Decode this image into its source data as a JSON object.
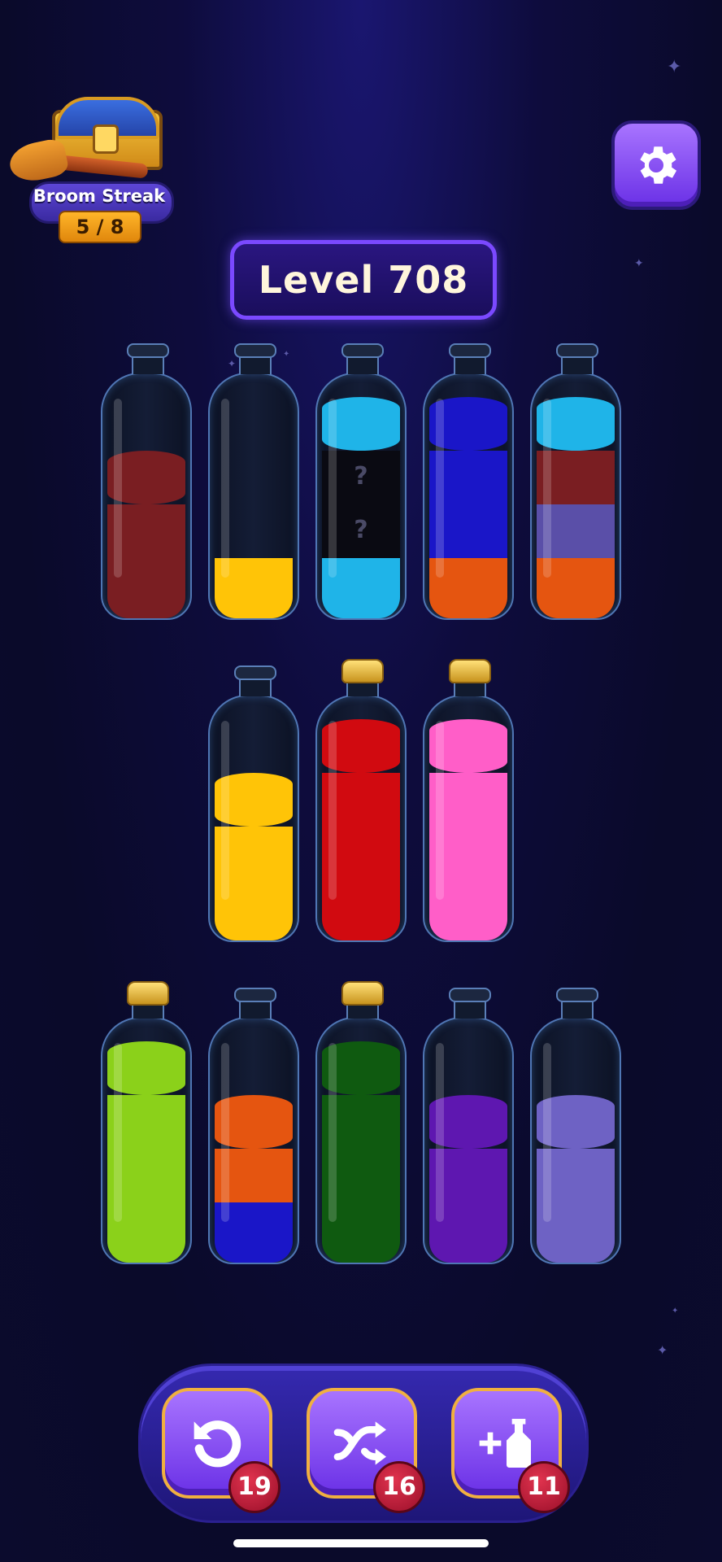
{
  "streak": {
    "title": "Broom Streak",
    "count": "5 / 8"
  },
  "level": {
    "label": "Level 708"
  },
  "icons": {
    "settings": "gear-icon",
    "undo": "undo-icon",
    "shuffle": "shuffle-icon",
    "add_bottle": "add-bottle-icon"
  },
  "tools": [
    {
      "name": "undo",
      "count": "19"
    },
    {
      "name": "shuffle",
      "count": "16"
    },
    {
      "name": "add-bottle",
      "count": "11"
    }
  ],
  "colors": {
    "maroon": "#7a1e22",
    "yellow": "#ffc407",
    "cyan": "#1fb4e8",
    "blue": "#1a16c8",
    "orange": "#e55510",
    "hidden": "#0a0a12",
    "slate": "#5a4fa8",
    "red": "#d10a10",
    "pink": "#ff5ec8",
    "lime": "#8bd11a",
    "green": "#0f5a10",
    "purple": "#5e17b0",
    "lavender": "#6e62c4"
  },
  "bottles": [
    {
      "capped": false,
      "layers": [
        "maroon",
        "maroon",
        "maroon"
      ]
    },
    {
      "capped": false,
      "layers": [
        "yellow"
      ]
    },
    {
      "capped": false,
      "layers": [
        "cyan",
        "hidden",
        "hidden",
        "cyan"
      ],
      "hidden_label": "?"
    },
    {
      "capped": false,
      "layers": [
        "orange",
        "blue",
        "blue",
        "blue"
      ]
    },
    {
      "capped": false,
      "layers": [
        "orange",
        "slate",
        "maroon",
        "cyan"
      ]
    },
    {
      "capped": false,
      "layers": [
        "yellow",
        "yellow",
        "yellow"
      ]
    },
    {
      "capped": true,
      "layers": [
        "red",
        "red",
        "red",
        "red"
      ]
    },
    {
      "capped": true,
      "layers": [
        "pink",
        "pink",
        "pink",
        "pink"
      ]
    },
    {
      "capped": true,
      "layers": [
        "lime",
        "lime",
        "lime",
        "lime"
      ]
    },
    {
      "capped": false,
      "layers": [
        "blue",
        "orange",
        "orange"
      ]
    },
    {
      "capped": true,
      "layers": [
        "green",
        "green",
        "green",
        "green"
      ]
    },
    {
      "capped": false,
      "layers": [
        "purple",
        "purple",
        "purple"
      ]
    },
    {
      "capped": false,
      "layers": [
        "lavender",
        "lavender",
        "lavender"
      ]
    }
  ]
}
